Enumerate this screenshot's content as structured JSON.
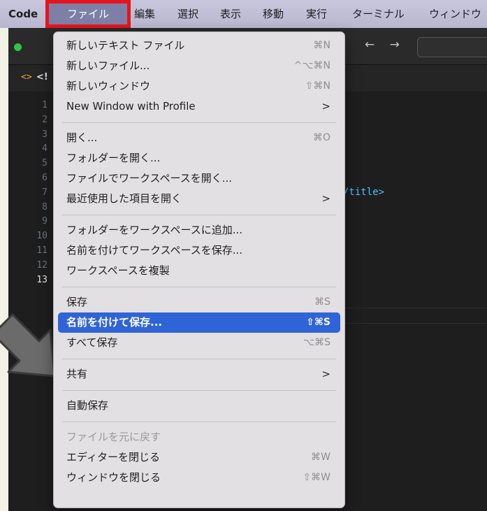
{
  "menubar": {
    "app": "Code",
    "items": [
      "ファイル",
      "編集",
      "選択",
      "表示",
      "移動",
      "実行",
      "ターミナル",
      "ウィンドウ"
    ],
    "highlight_color": "#e8141b"
  },
  "editor": {
    "tab_icon": "<>",
    "tab_label": "<!",
    "nav_arrows": "← →",
    "line_numbers": [
      "1",
      "2",
      "3",
      "4",
      "5",
      "6",
      "7",
      "8",
      "9",
      "10",
      "11",
      "12",
      "13"
    ],
    "active_line": "13",
    "visible_code": "/title>"
  },
  "file_menu": {
    "groups": [
      [
        {
          "label": "新しいテキスト ファイル",
          "shortcut": "⌘N"
        },
        {
          "label": "新しいファイル...",
          "shortcut": "^⌥⌘N"
        },
        {
          "label": "新しいウィンドウ",
          "shortcut": "⇧⌘N"
        },
        {
          "label": "New Window with Profile",
          "submenu": ">"
        }
      ],
      [
        {
          "label": "開く...",
          "shortcut": "⌘O"
        },
        {
          "label": "フォルダーを開く..."
        },
        {
          "label": "ファイルでワークスペースを開く..."
        },
        {
          "label": "最近使用した項目を開く",
          "submenu": ">"
        }
      ],
      [
        {
          "label": "フォルダーをワークスペースに追加..."
        },
        {
          "label": "名前を付けてワークスペースを保存..."
        },
        {
          "label": "ワークスペースを複製"
        }
      ],
      [
        {
          "label": "保存",
          "shortcut": "⌘S"
        },
        {
          "label": "名前を付けて保存...",
          "shortcut": "⇧⌘S",
          "highlighted": true
        },
        {
          "label": "すべて保存",
          "shortcut": "⌥⌘S"
        }
      ],
      [
        {
          "label": "共有",
          "submenu": ">"
        }
      ],
      [
        {
          "label": "自動保存"
        }
      ],
      [
        {
          "label": "ファイルを元に戻す",
          "disabled": true
        },
        {
          "label": "エディターを閉じる",
          "shortcut": "⌘W"
        },
        {
          "label": "ウィンドウを閉じる",
          "shortcut": "⇧⌘W"
        }
      ]
    ],
    "highlight_bg": "#2f64d6"
  },
  "annotation": {
    "arrow_icon": "arrow-pointing-icon",
    "arrow_color": "#6b6b6b"
  }
}
